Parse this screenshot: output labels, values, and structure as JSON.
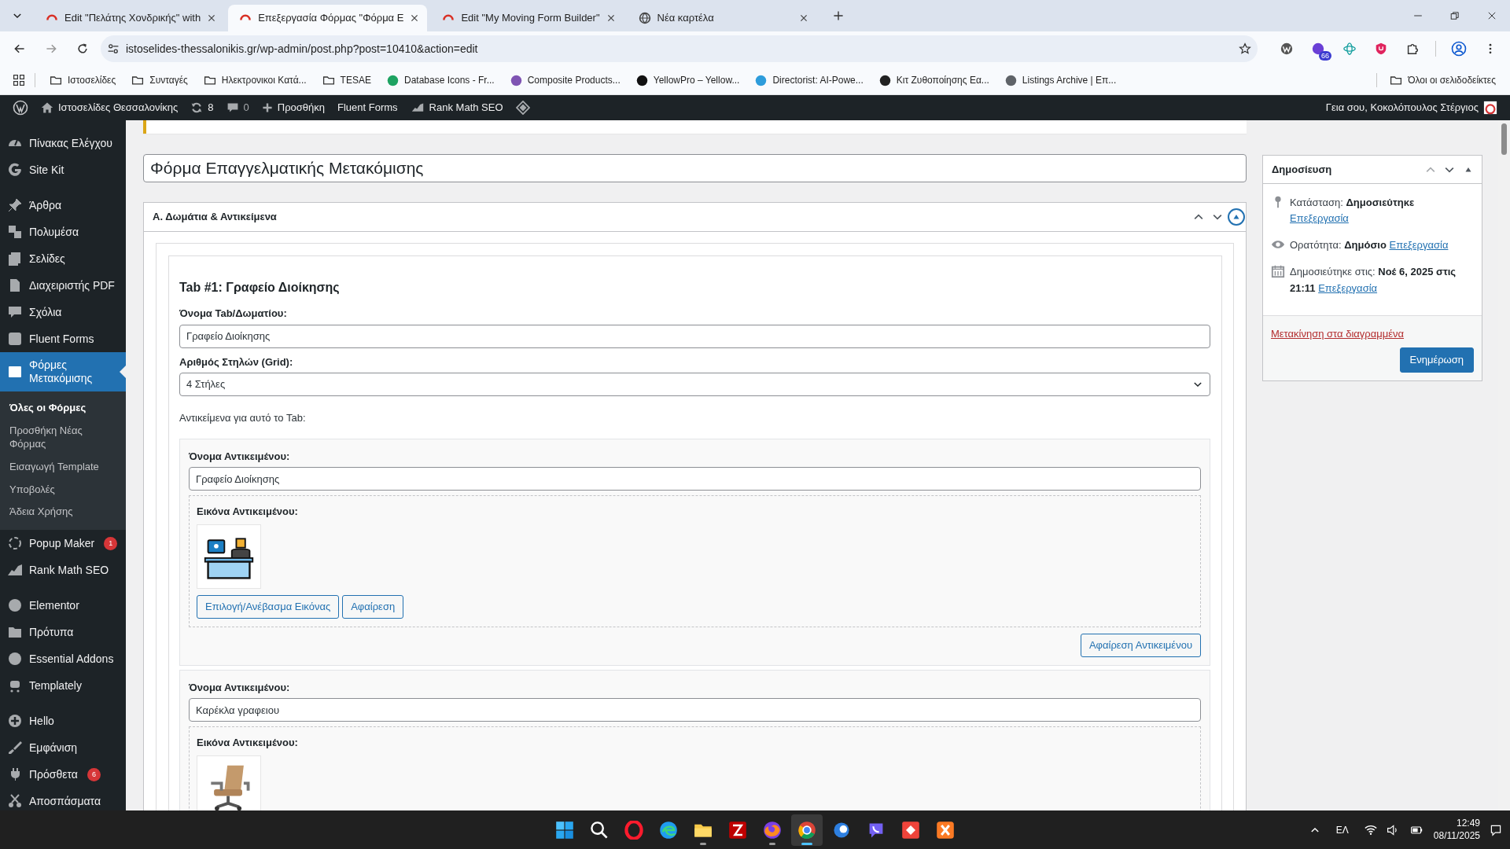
{
  "browser": {
    "tabs": [
      {
        "title": "Edit \"Πελάτης Χονδρικής\" with",
        "selected": false
      },
      {
        "title": "Επεξεργασία Φόρμας \"Φόρμα Ε",
        "selected": true
      },
      {
        "title": "Edit \"My Moving Form Builder\"",
        "selected": false
      },
      {
        "title": "Νέα καρτέλα",
        "selected": false
      }
    ],
    "address": "istoselides-thessalonikis.gr/wp-admin/post.php?post=10410&action=edit",
    "extension_badge": "66",
    "bookmarks": [
      {
        "label": "Ιστοσελίδες",
        "kind": "folder"
      },
      {
        "label": "Συνταγές",
        "kind": "folder"
      },
      {
        "label": "Ηλεκτρονικοι Κατά...",
        "kind": "folder"
      },
      {
        "label": "TESAE",
        "kind": "folder"
      },
      {
        "label": "Database Icons - Fr...",
        "kind": "site",
        "color": "#1ea362"
      },
      {
        "label": "Composite Products...",
        "kind": "site",
        "color": "#7f54b3"
      },
      {
        "label": "YellowPro – Yellow...",
        "kind": "site",
        "color": "#111111"
      },
      {
        "label": "Directorist: AI-Powe...",
        "kind": "site",
        "color": "#2d9cdb"
      },
      {
        "label": "Κιτ Ζυθοποίησης Εα...",
        "kind": "site",
        "color": "#222222"
      },
      {
        "label": "Listings Archive | Επ...",
        "kind": "site",
        "color": "#5f6368"
      }
    ],
    "all_bookmarks": "Όλοι οι σελιδοδείκτες"
  },
  "admin_bar": {
    "site_name": "Ιστοσελίδες Θεσσαλονίκης",
    "updates": "8",
    "comments": "0",
    "new": "Προσθήκη",
    "links": [
      "Fluent Forms",
      "Rank Math SEO"
    ],
    "greeting": "Γεια σου, Κοκολόπουλος Στέργιος"
  },
  "sidebar": {
    "groups": [
      {
        "items": [
          {
            "label": "Πίνακας Ελέγχου",
            "selected": false
          },
          {
            "label": "Site Kit",
            "selected": false
          }
        ]
      },
      {
        "items": [
          {
            "label": "Άρθρα",
            "selected": false
          },
          {
            "label": "Πολυμέσα",
            "selected": false
          },
          {
            "label": "Σελίδες",
            "selected": false
          },
          {
            "label": "Διαχειριστής PDF",
            "selected": false
          },
          {
            "label": "Σχόλια",
            "selected": false
          },
          {
            "label": "Fluent Forms",
            "selected": false
          },
          {
            "label": "Φόρμες Μετακόμισης",
            "selected": true,
            "children": [
              {
                "label": "Όλες οι Φόρμες",
                "selected": true
              },
              {
                "label": "Προσθήκη Νέας Φόρμας",
                "selected": false
              },
              {
                "label": "Εισαγωγή Template",
                "selected": false
              },
              {
                "label": "Υποβολές",
                "selected": false
              },
              {
                "label": "Άδεια Χρήσης",
                "selected": false
              }
            ]
          },
          {
            "label": "Popup Maker",
            "selected": false,
            "badge": "1"
          },
          {
            "label": "Rank Math SEO",
            "selected": false
          }
        ]
      },
      {
        "items": [
          {
            "label": "Elementor",
            "selected": false
          },
          {
            "label": "Πρότυπα",
            "selected": false
          },
          {
            "label": "Essential Addons",
            "selected": false
          },
          {
            "label": "Templately",
            "selected": false
          }
        ]
      },
      {
        "items": [
          {
            "label": "Hello",
            "selected": false
          },
          {
            "label": "Εμφάνιση",
            "selected": false
          },
          {
            "label": "Πρόσθετα",
            "selected": false,
            "badge": "6"
          },
          {
            "label": "Αποσπάσματα",
            "selected": false
          }
        ]
      }
    ]
  },
  "post_title": "Φόρμα Επαγγελματικής Μετακόμισης",
  "metabox": {
    "title": "Α. Δωμάτια & Αντικείμενα",
    "tab": {
      "heading": "Tab #1: Γραφείο Διοίκησης",
      "name_label": "Όνομα Tab/Δωματίου:",
      "name_value": "Γραφείο Διοίκησης",
      "grid_label": "Αριθμός Στηλών (Grid):",
      "grid_value": "4 Στήλες",
      "items_label": "Αντικείμενα για αυτό το Tab:",
      "items": [
        {
          "name_label": "Όνομα Αντικειμένου:",
          "name_value": "Γραφείο Διοίκησης",
          "image_label": "Εικόνα Αντικειμένου:",
          "buttons": [
            "Επιλογή/Ανέβασμα Εικόνας",
            "Αφαίρεση"
          ],
          "remove": "Αφαίρεση Αντικειμένου"
        },
        {
          "name_label": "Όνομα Αντικειμένου:",
          "name_value": "Καρέκλα γραφειου",
          "image_label": "Εικόνα Αντικειμένου:"
        }
      ]
    }
  },
  "publish": {
    "title": "Δημοσίευση",
    "status": "Κατάσταση: **Δημοσιεύτηκε**",
    "status_link": "Επεξεργασία",
    "visibility": "Ορατότητα: **Δημόσιο**",
    "visibility_link": "Επεξεργασία",
    "date": "Δημοσιεύτηκε στις: **Νοέ 6, 2025 στις 21:11**",
    "date_link": "Επεξεργασία",
    "trash": "Μετακίνηση στα διαγραμμένα",
    "update": "Ενημέρωση"
  },
  "taskbar": {
    "apps": [
      {
        "running": false,
        "selected": false
      },
      {
        "running": false,
        "selected": false
      },
      {
        "running": false,
        "selected": false
      },
      {
        "running": false,
        "selected": false
      },
      {
        "running": true,
        "selected": false
      },
      {
        "running": false,
        "selected": false
      },
      {
        "running": true,
        "selected": false
      },
      {
        "running": true,
        "selected": true
      },
      {
        "running": false,
        "selected": false
      },
      {
        "running": false,
        "selected": false
      },
      {
        "running": false,
        "selected": false
      },
      {
        "running": false,
        "selected": false
      }
    ],
    "language": "ΕΛ",
    "time": "12:49",
    "date": "08/11/2025"
  }
}
